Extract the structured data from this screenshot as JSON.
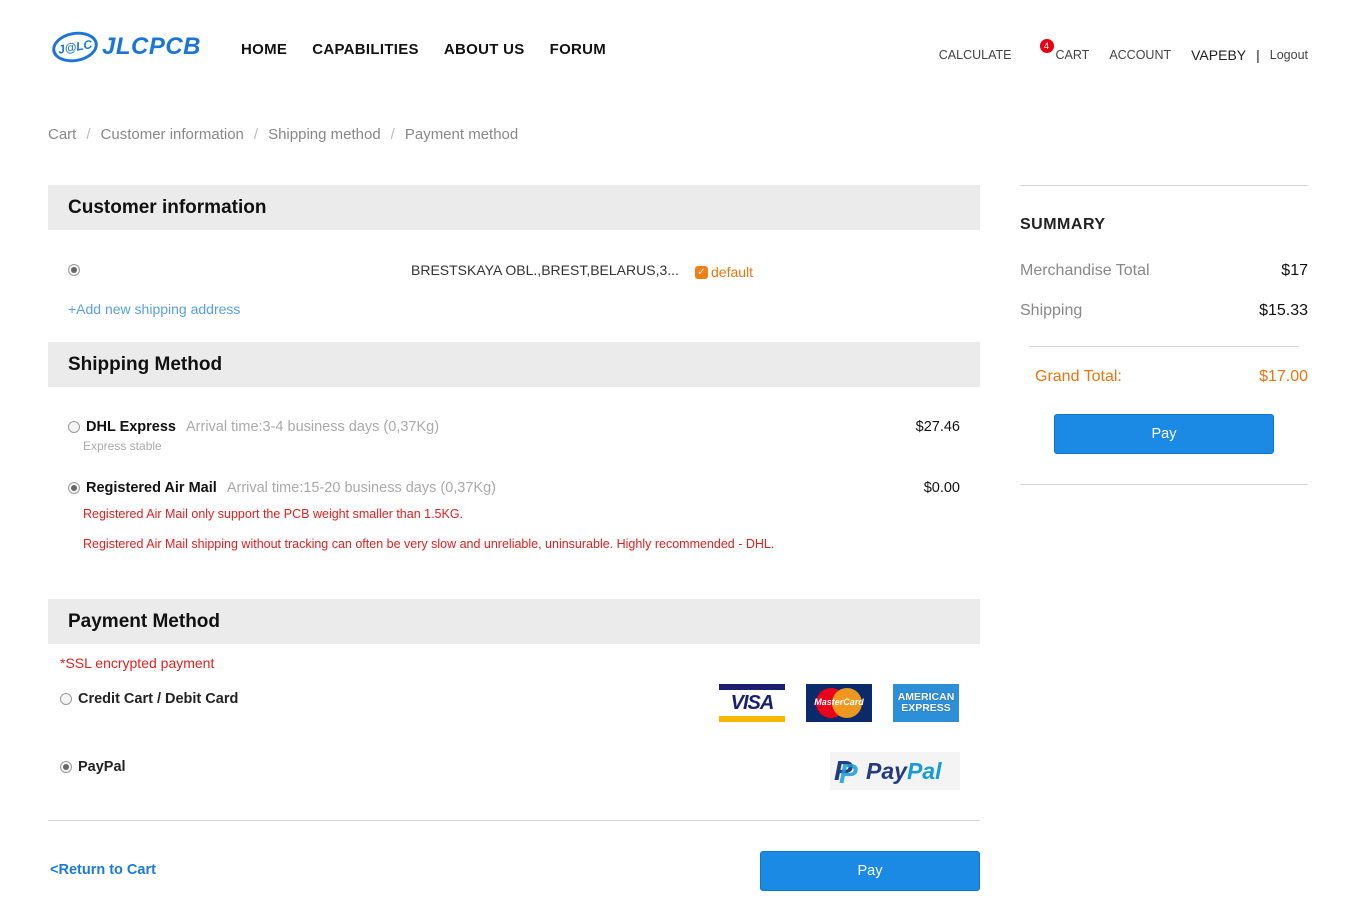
{
  "header": {
    "logo_badge": "J@LC",
    "logo_text": "JLCPCB",
    "nav": [
      "HOME",
      "CAPABILITIES",
      "ABOUT US",
      "FORUM"
    ],
    "calculate": "CALCULATE",
    "cart_count": "4",
    "cart": "CART",
    "account": "ACCOUNT",
    "username": "VAPEBY",
    "separator": "|",
    "logout": "Logout"
  },
  "breadcrumb": [
    "Cart",
    "Customer information",
    "Shipping method",
    "Payment method"
  ],
  "customer": {
    "title": "Customer information",
    "address": "BRESTSKAYA OBL.,BREST,BELARUS,3...",
    "default_check": "✓",
    "default_label": "default",
    "add_address": "+Add new shipping address"
  },
  "shipping": {
    "title": "Shipping Method",
    "options": [
      {
        "name": "DHL Express",
        "arrival": "Arrival time:3-4 business days (0,37Kg)",
        "price": "$27.46",
        "sub": "Express stable",
        "selected": false
      },
      {
        "name": "Registered Air Mail",
        "arrival": "Arrival time:15-20 business days (0,37Kg)",
        "price": "$0.00",
        "selected": true
      }
    ],
    "warnings": [
      "Registered Air Mail only support the PCB weight smaller than 1.5KG.",
      "Registered Air Mail shipping without tracking can often be very slow and unreliable, uninsurable. Highly recommended - DHL."
    ]
  },
  "payment": {
    "title": "Payment Method",
    "ssl_note": "*SSL encrypted payment",
    "card_option": "Credit Cart / Debit Card",
    "paypal_option": "PayPal",
    "logos": {
      "visa": "VISA",
      "mastercard": "MasterCard",
      "amex_line1": "AMERICAN",
      "amex_line2": "EXPRESS",
      "paypal_pay": "Pay",
      "paypal_pal": "Pal"
    }
  },
  "footer": {
    "return_link": "<Return to Cart",
    "pay_label": "Pay"
  },
  "summary": {
    "title": "SUMMARY",
    "merch_label": "Merchandise Total",
    "merch_value": "$17",
    "shipping_label": "Shipping",
    "shipping_value": "$15.33",
    "grand_label": "Grand Total:",
    "grand_value": "$17.00",
    "pay_label": "Pay"
  },
  "colors": {
    "accent_blue": "#1a8ae5",
    "warning_red": "#e02020",
    "orange": "#e8750f"
  }
}
